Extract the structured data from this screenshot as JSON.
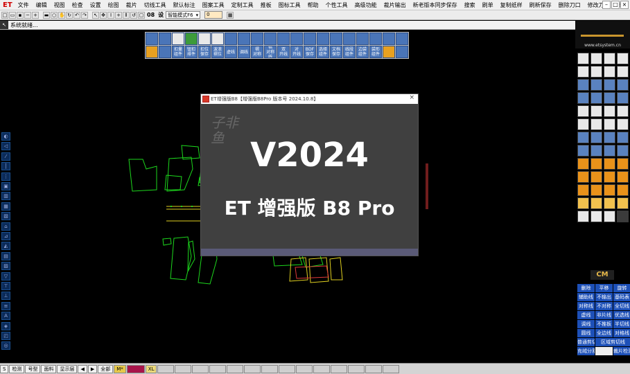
{
  "app": {
    "logo": "ET",
    "menu": [
      "文件",
      "编辑",
      "视图",
      "检查",
      "设置",
      "绘图",
      "裁片",
      "切线工具",
      "默认标注",
      "图案工具",
      "定制工具",
      "推板",
      "图标工具",
      "帮助",
      "个性工具",
      "高级功能",
      "裁片输出",
      "新老版本同步保存",
      "搜索",
      "刷单",
      "复制纸样",
      "刷新保存",
      "删除刀口",
      "修改刀口",
      "单图"
    ]
  },
  "window_controls": {
    "min": "–",
    "max": "□",
    "close": "×"
  },
  "toolbar": {
    "text_item": "08",
    "text_item2": "设",
    "mode_value": "智能模式F6",
    "number_value": "0"
  },
  "status": {
    "text": "系统就绪..."
  },
  "splash": {
    "title": "ET增强版B8【增强版B8Pro 版本号 2024.10.8】",
    "brand": "子非鱼",
    "version": "V2024",
    "product": "ET 增强版 B8 Pro",
    "close": "×"
  },
  "right_panel": {
    "site": "www.etsystem.cn",
    "cm_label": "CM",
    "buttons": [
      [
        "删除",
        "平移",
        "旋转"
      ],
      [
        "辅助线",
        "不输出",
        "基码表"
      ],
      [
        "对称线",
        "不对称",
        "全切线"
      ],
      [
        "虚线",
        "非片线",
        "优选线"
      ],
      [
        "调线",
        "不推板",
        "半切线"
      ],
      [
        "圆线",
        "全边线",
        "对格线"
      ]
    ],
    "wide_btn": "普通剪切线",
    "wide_btn2": "区域剪切线",
    "last_row": [
      "充绒分割",
      "",
      "裁片检测"
    ]
  },
  "pattern_tools": {
    "row2_labels": [
      "",
      "",
      "扣量\n组件",
      "钮扣\n排件",
      "扣位\n保存",
      "波浪\n褶位",
      "虚线",
      "调线",
      "褶\n对称",
      "褶\n对称线",
      "双\n开线",
      "对\n开线",
      "BDF\n保存",
      "选择\n组件",
      "文档\n保存",
      "线段\n组件",
      "边袋\n组件",
      "袋形\n组件",
      "",
      ""
    ]
  },
  "bottom_bar": {
    "items": [
      "S",
      "检测",
      "号型",
      "面料",
      "显示层",
      "◀",
      "▶",
      "全部",
      "M*",
      "",
      "XL"
    ]
  },
  "colors": {
    "accent_blue": "#1d50b8",
    "pattern_green": "#1dd81d",
    "pattern_yellow": "#e0d020",
    "pattern_red": "#e03a3a"
  }
}
